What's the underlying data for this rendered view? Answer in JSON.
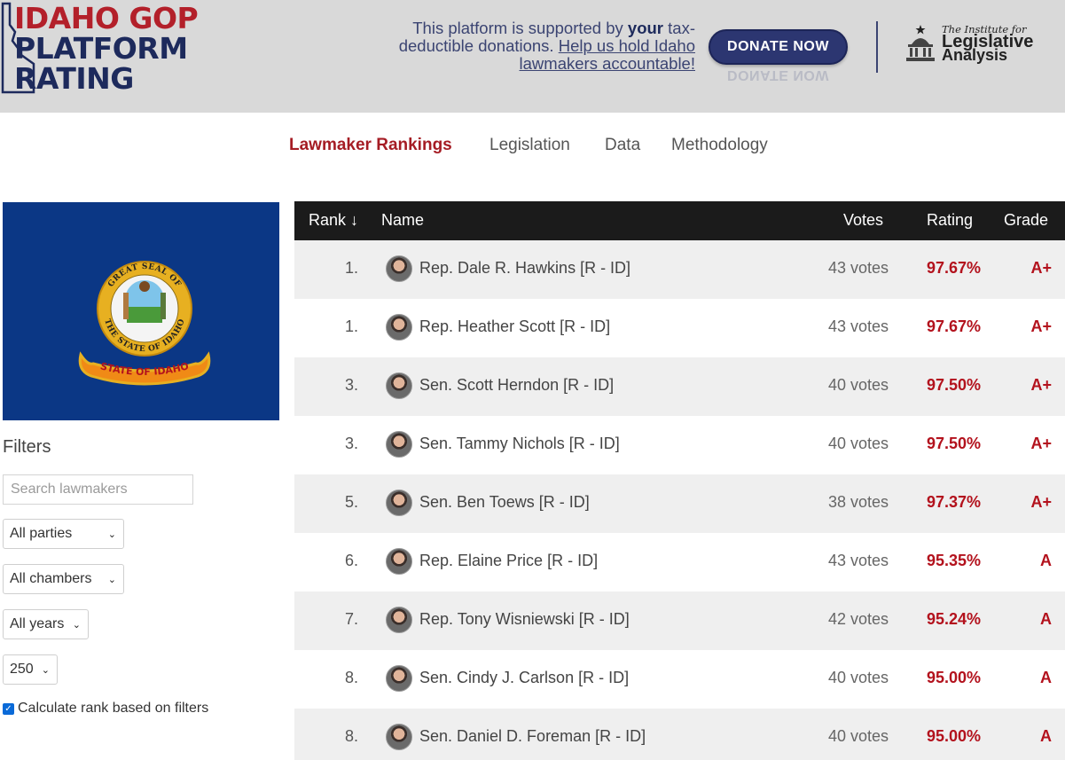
{
  "header": {
    "logo_line1": "IDAHO GOP",
    "logo_line2": "PLATFORM",
    "logo_line3": "RATING",
    "promo_pre": "This platform is supported by ",
    "promo_bold": "your",
    "promo_post": " tax-deductible donations. ",
    "promo_link": "Help us hold Idaho lawmakers accountable!",
    "donate_label": "DONATE NOW",
    "institute_line1": "The Institute for",
    "institute_line2": "Legislative",
    "institute_line3": "Analysis"
  },
  "nav": {
    "items": [
      {
        "label": "Lawmaker Rankings",
        "active": true
      },
      {
        "label": "Legislation",
        "active": false
      },
      {
        "label": "Data",
        "active": false
      },
      {
        "label": "Methodology",
        "active": false
      }
    ]
  },
  "sidebar": {
    "flag": {
      "seal_top": "GREAT SEAL OF",
      "seal_bottom": "THE STATE OF IDAHO",
      "banner": "STATE OF IDAHO"
    },
    "filters_title": "Filters",
    "search_placeholder": "Search lawmakers",
    "party_select": "All parties",
    "chamber_select": "All chambers",
    "year_select": "All years",
    "limit_select": "250",
    "calc_rank_label": "Calculate rank based on filters",
    "calc_rank_checked": true
  },
  "table": {
    "headers": {
      "rank": "Rank ↓",
      "name": "Name",
      "votes": "Votes",
      "rating": "Rating",
      "grade": "Grade"
    },
    "rows": [
      {
        "rank": "1.",
        "name": "Rep. Dale R. Hawkins [R - ID]",
        "votes": "43 votes",
        "rating": "97.67%",
        "grade": "A+"
      },
      {
        "rank": "1.",
        "name": "Rep. Heather Scott [R - ID]",
        "votes": "43 votes",
        "rating": "97.67%",
        "grade": "A+"
      },
      {
        "rank": "3.",
        "name": "Sen. Scott Herndon [R - ID]",
        "votes": "40 votes",
        "rating": "97.50%",
        "grade": "A+"
      },
      {
        "rank": "3.",
        "name": "Sen. Tammy Nichols [R - ID]",
        "votes": "40 votes",
        "rating": "97.50%",
        "grade": "A+"
      },
      {
        "rank": "5.",
        "name": "Sen. Ben Toews [R - ID]",
        "votes": "38 votes",
        "rating": "97.37%",
        "grade": "A+"
      },
      {
        "rank": "6.",
        "name": "Rep. Elaine Price [R - ID]",
        "votes": "43 votes",
        "rating": "95.35%",
        "grade": "A"
      },
      {
        "rank": "7.",
        "name": "Rep. Tony Wisniewski [R - ID]",
        "votes": "42 votes",
        "rating": "95.24%",
        "grade": "A"
      },
      {
        "rank": "8.",
        "name": "Sen. Cindy J. Carlson [R - ID]",
        "votes": "40 votes",
        "rating": "95.00%",
        "grade": "A"
      },
      {
        "rank": "8.",
        "name": "Sen. Daniel D. Foreman [R - ID]",
        "votes": "40 votes",
        "rating": "95.00%",
        "grade": "A"
      }
    ]
  },
  "colors": {
    "header_bg": "#d9d9d9",
    "brand_red": "#b3202a",
    "brand_navy": "#1d2a5c",
    "donate_bg": "#2c3671",
    "rating_red": "#b3121d",
    "flag_blue": "#0b3785",
    "table_head": "#1b1b1b"
  }
}
